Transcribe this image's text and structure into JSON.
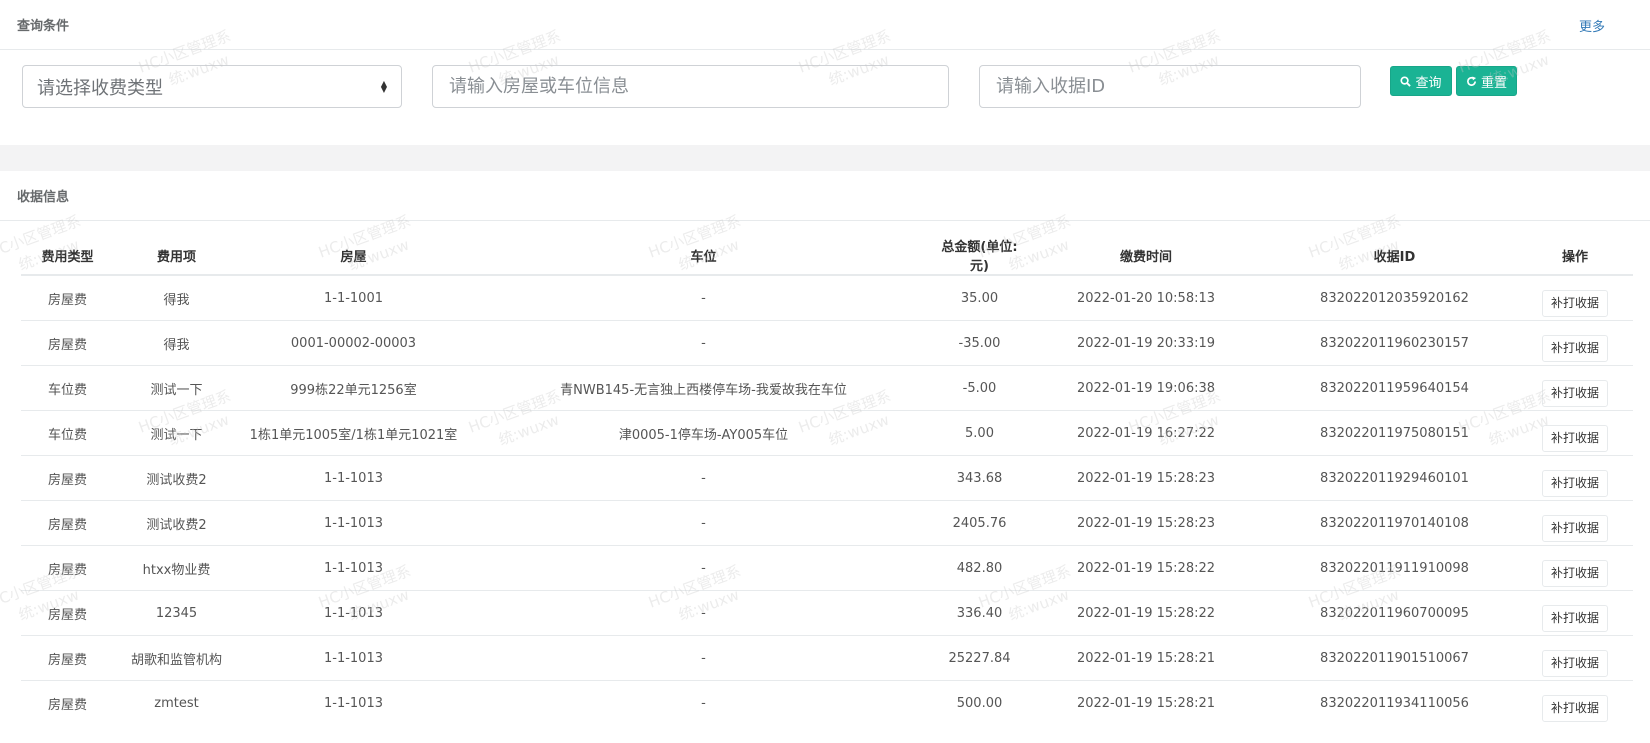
{
  "search": {
    "title": "查询条件",
    "more_label": "更多",
    "fee_type_placeholder": "请选择收费类型",
    "room_placeholder": "请输入房屋或车位信息",
    "receipt_id_placeholder": "请输入收据ID",
    "query_label": "查询",
    "reset_label": "重置"
  },
  "receipts": {
    "title": "收据信息",
    "columns": [
      "费用类型",
      "费用项",
      "房屋",
      "车位",
      "总金额(单位:元)",
      "缴费时间",
      "收据ID",
      "操作"
    ],
    "action_label": "补打收据",
    "rows": [
      {
        "fee_type": "房屋费",
        "fee_item": "得我",
        "room": "1-1-1001",
        "parking": "-",
        "amount": "35.00",
        "time": "2022-01-20 10:58:13",
        "receipt_id": "832022012035920162"
      },
      {
        "fee_type": "房屋费",
        "fee_item": "得我",
        "room": "0001-00002-00003",
        "parking": "-",
        "amount": "-35.00",
        "time": "2022-01-19 20:33:19",
        "receipt_id": "832022011960230157"
      },
      {
        "fee_type": "车位费",
        "fee_item": "测试一下",
        "room": "999栋22单元1256室",
        "parking": "青NWB145-无言独上西楼停车场-我爱故我在车位",
        "amount": "-5.00",
        "time": "2022-01-19 19:06:38",
        "receipt_id": "832022011959640154"
      },
      {
        "fee_type": "车位费",
        "fee_item": "测试一下",
        "room": "1栋1单元1005室/1栋1单元1021室",
        "parking": "津0005-1停车场-AY005车位",
        "amount": "5.00",
        "time": "2022-01-19 16:27:22",
        "receipt_id": "832022011975080151"
      },
      {
        "fee_type": "房屋费",
        "fee_item": "测试收费2",
        "room": "1-1-1013",
        "parking": "-",
        "amount": "343.68",
        "time": "2022-01-19 15:28:23",
        "receipt_id": "832022011929460101"
      },
      {
        "fee_type": "房屋费",
        "fee_item": "测试收费2",
        "room": "1-1-1013",
        "parking": "-",
        "amount": "2405.76",
        "time": "2022-01-19 15:28:23",
        "receipt_id": "832022011970140108"
      },
      {
        "fee_type": "房屋费",
        "fee_item": "htxx物业费",
        "room": "1-1-1013",
        "parking": "-",
        "amount": "482.80",
        "time": "2022-01-19 15:28:22",
        "receipt_id": "832022011911910098"
      },
      {
        "fee_type": "房屋费",
        "fee_item": "12345",
        "room": "1-1-1013",
        "parking": "-",
        "amount": "336.40",
        "time": "2022-01-19 15:28:22",
        "receipt_id": "832022011960700095"
      },
      {
        "fee_type": "房屋费",
        "fee_item": "胡歌和监管机构",
        "room": "1-1-1013",
        "parking": "-",
        "amount": "25227.84",
        "time": "2022-01-19 15:28:21",
        "receipt_id": "832022011901510067"
      },
      {
        "fee_type": "房屋费",
        "fee_item": "zmtest",
        "room": "1-1-1013",
        "parking": "-",
        "amount": "500.00",
        "time": "2022-01-19 15:28:21",
        "receipt_id": "832022011934110056"
      }
    ]
  },
  "watermark": {
    "line1": "HC小区管理系",
    "line2": "统:wuxw"
  },
  "colors": {
    "primary": "#1ab394",
    "link": "#337ab7"
  },
  "icons": {
    "query": "search-icon",
    "reset": "refresh-icon"
  }
}
